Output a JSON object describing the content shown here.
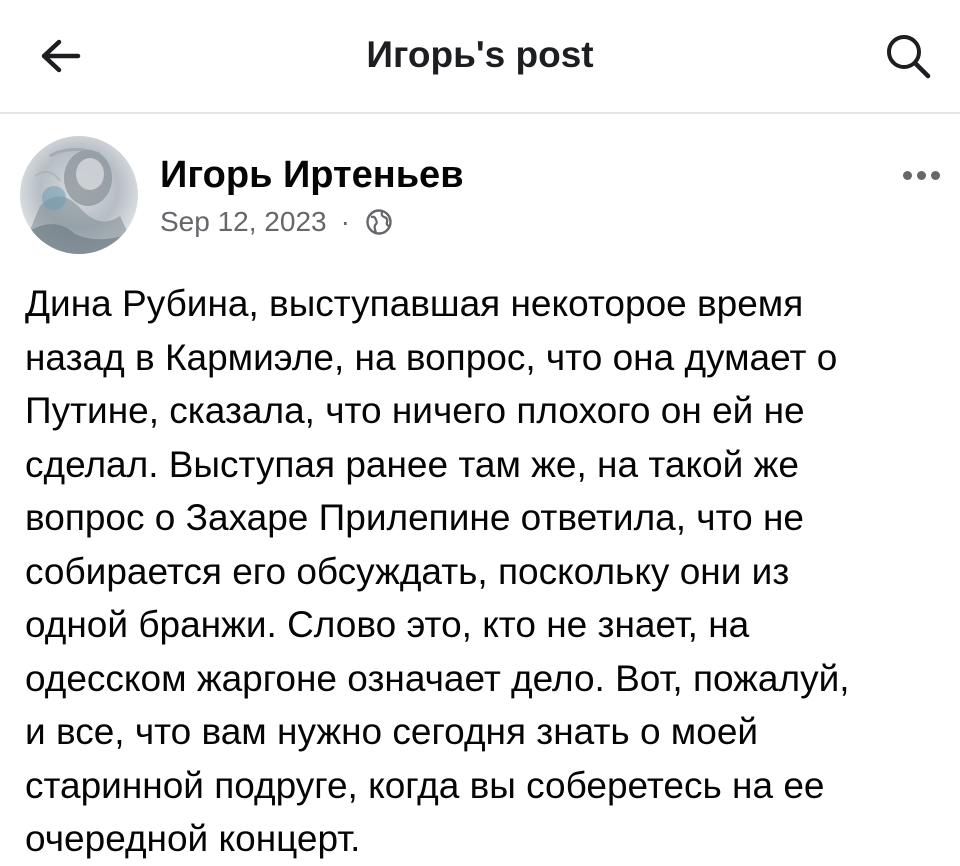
{
  "header": {
    "title": "Игорь's post",
    "back_icon": "arrow-left-icon",
    "search_icon": "search-icon"
  },
  "post": {
    "author": "Игорь Иртеньев",
    "date": "Sep 12, 2023",
    "separator": "·",
    "privacy_icon": "globe-icon",
    "more_icon": "more-options-icon",
    "body_lines": [
      "Дина Рубина, выступавшая некоторое время",
      "назад в Кармиэле, на вопрос, что она думает о",
      "Путине, сказала, что ничего плохого он ей не",
      "сделал. Выступая ранее там же, на такой же",
      "вопрос о Захаре Прилепине ответила, что не",
      "собирается его обсуждать, поскольку они из",
      "одной бранжи. Слово это, кто не знает, на",
      "одесском жаргоне означает дело. Вот, пожалуй,",
      "и все, что вам нужно сегодня знать о моей",
      "старинной подруге, когда вы соберетесь на ее",
      "очередной концерт."
    ]
  },
  "colors": {
    "text_primary": "#050505",
    "text_secondary": "#65676b",
    "divider": "#e4e6eb"
  }
}
